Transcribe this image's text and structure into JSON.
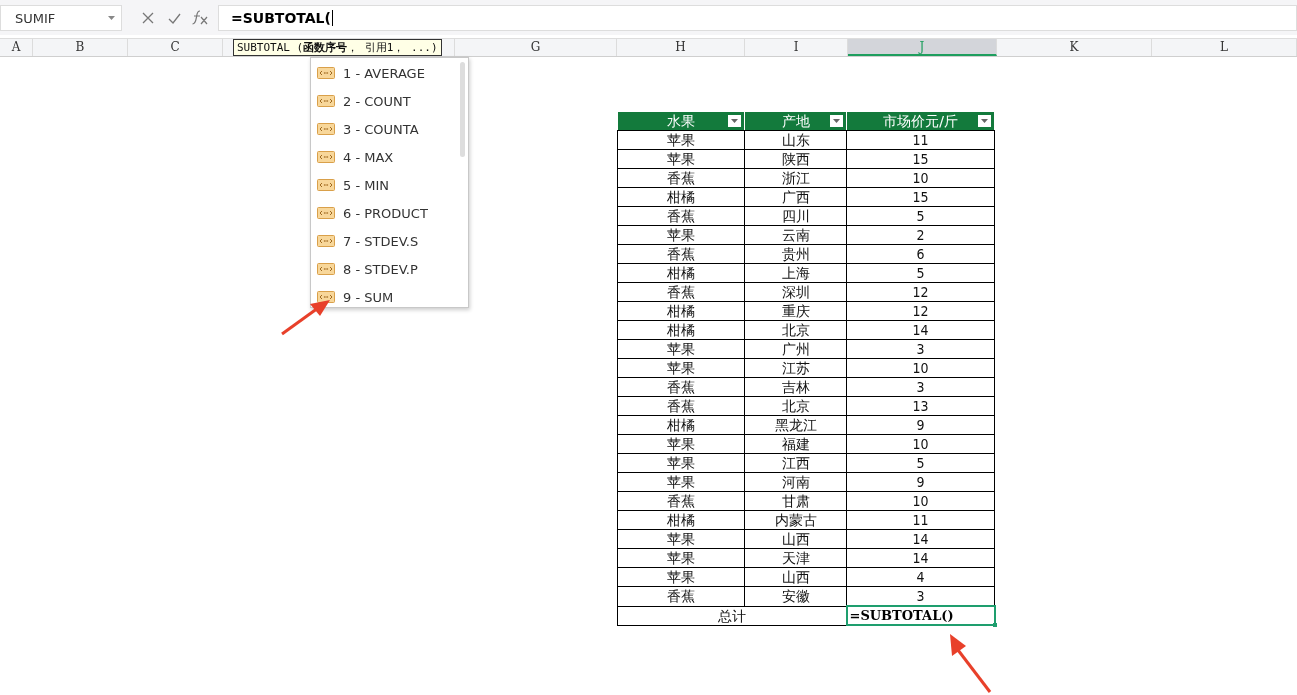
{
  "name_box": {
    "value": "SUMIF"
  },
  "formula_bar": {
    "value": "=SUBTOTAL("
  },
  "column_headers": [
    {
      "label": "A",
      "selected": false
    },
    {
      "label": "B",
      "selected": false
    },
    {
      "label": "C",
      "selected": false
    },
    {
      "label": "G",
      "selected": false
    },
    {
      "label": "H",
      "selected": false
    },
    {
      "label": "I",
      "selected": false
    },
    {
      "label": "J",
      "selected": true
    },
    {
      "label": "K",
      "selected": false
    },
    {
      "label": "L",
      "selected": false
    }
  ],
  "function_tooltip": {
    "text": "SUBTOTAL (**函数序号**， 引用1， ...)"
  },
  "autocomplete": {
    "items": [
      "1 - AVERAGE",
      "2 - COUNT",
      "3 - COUNTA",
      "4 - MAX",
      "5 - MIN",
      "6 - PRODUCT",
      "7 - STDEV.S",
      "8 - STDEV.P",
      "9 - SUM"
    ]
  },
  "table": {
    "columns": [
      "水果",
      "产地",
      "市场价元/斤"
    ],
    "rows": [
      [
        "苹果",
        "山东",
        "11"
      ],
      [
        "苹果",
        "陕西",
        "15"
      ],
      [
        "香蕉",
        "浙江",
        "10"
      ],
      [
        "柑橘",
        "广西",
        "15"
      ],
      [
        "香蕉",
        "四川",
        "5"
      ],
      [
        "苹果",
        "云南",
        "2"
      ],
      [
        "香蕉",
        "贵州",
        "6"
      ],
      [
        "柑橘",
        "上海",
        "5"
      ],
      [
        "香蕉",
        "深圳",
        "12"
      ],
      [
        "柑橘",
        "重庆",
        "12"
      ],
      [
        "柑橘",
        "北京",
        "14"
      ],
      [
        "苹果",
        "广州",
        "3"
      ],
      [
        "苹果",
        "江苏",
        "10"
      ],
      [
        "香蕉",
        "吉林",
        "3"
      ],
      [
        "香蕉",
        "北京",
        "13"
      ],
      [
        "柑橘",
        "黑龙江",
        "9"
      ],
      [
        "苹果",
        "福建",
        "10"
      ],
      [
        "苹果",
        "江西",
        "5"
      ],
      [
        "苹果",
        "河南",
        "9"
      ],
      [
        "香蕉",
        "甘肃",
        "10"
      ],
      [
        "柑橘",
        "内蒙古",
        "11"
      ],
      [
        "苹果",
        "山西",
        "14"
      ],
      [
        "苹果",
        "天津",
        "14"
      ],
      [
        "苹果",
        "山西",
        "4"
      ],
      [
        "香蕉",
        "安徽",
        "3"
      ]
    ],
    "total": {
      "label": "总计",
      "value": "=SUBTOTAL()",
      "active": true
    }
  }
}
